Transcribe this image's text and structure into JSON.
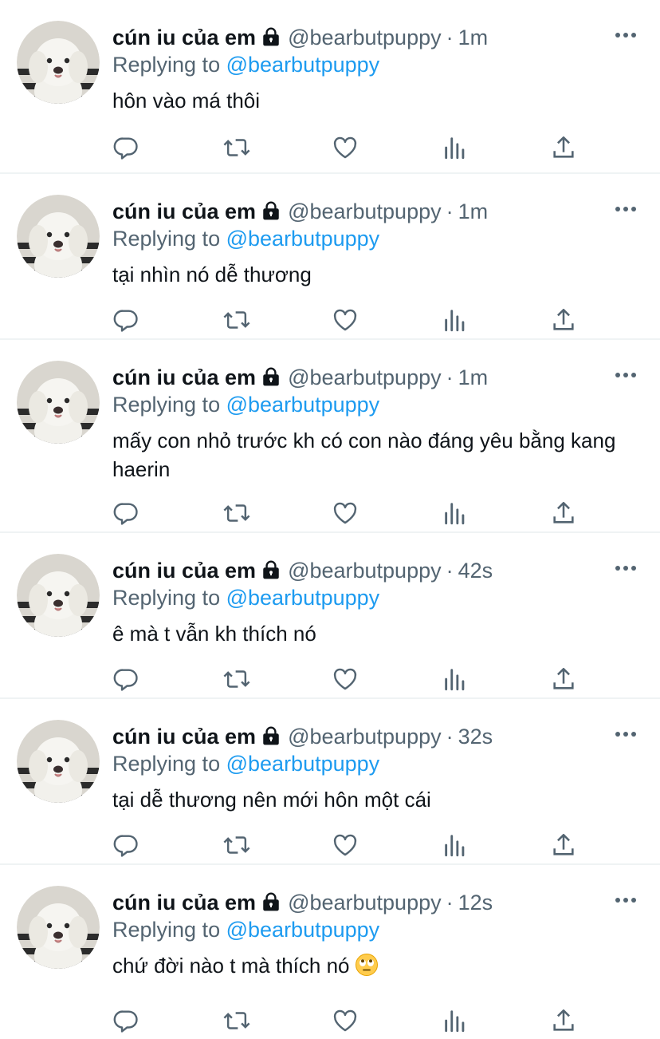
{
  "tweets": [
    {
      "name": "cún iu của em",
      "handle": "@bearbutpuppy",
      "time": "1m",
      "replying_prefix": "Replying to",
      "replying_handle": "@bearbutpuppy",
      "text": "hôn vào má thôi",
      "emoji": ""
    },
    {
      "name": "cún iu của em",
      "handle": "@bearbutpuppy",
      "time": "1m",
      "replying_prefix": "Replying to",
      "replying_handle": "@bearbutpuppy",
      "text": "tại nhìn nó dễ thương",
      "emoji": ""
    },
    {
      "name": "cún iu của em",
      "handle": "@bearbutpuppy",
      "time": "1m",
      "replying_prefix": "Replying to",
      "replying_handle": "@bearbutpuppy",
      "text": "mấy con nhỏ trước kh có con nào đáng yêu bằng kang haerin",
      "emoji": ""
    },
    {
      "name": "cún iu của em",
      "handle": "@bearbutpuppy",
      "time": "42s",
      "replying_prefix": "Replying to",
      "replying_handle": "@bearbutpuppy",
      "text": "ê mà t vẫn kh thích nó",
      "emoji": ""
    },
    {
      "name": "cún iu của em",
      "handle": "@bearbutpuppy",
      "time": "32s",
      "replying_prefix": "Replying to",
      "replying_handle": "@bearbutpuppy",
      "text": "tại dễ thương nên mới hôn một cái",
      "emoji": ""
    },
    {
      "name": "cún iu của em",
      "handle": "@bearbutpuppy",
      "time": "12s",
      "replying_prefix": "Replying to",
      "replying_handle": "@bearbutpuppy",
      "text": "chứ đời nào t mà thích nó",
      "emoji": "face-with-rolling-eyes-emoji"
    }
  ],
  "icons": {
    "protected": "lock-icon",
    "more": "more-options-icon",
    "reply": "reply-icon",
    "retweet": "retweet-icon",
    "like": "heart-icon",
    "views": "analytics-icon",
    "share": "share-icon"
  },
  "colors": {
    "text": "#0f1419",
    "secondary": "#536471",
    "accent": "#1d9bf0",
    "divider": "#eff3f4"
  }
}
